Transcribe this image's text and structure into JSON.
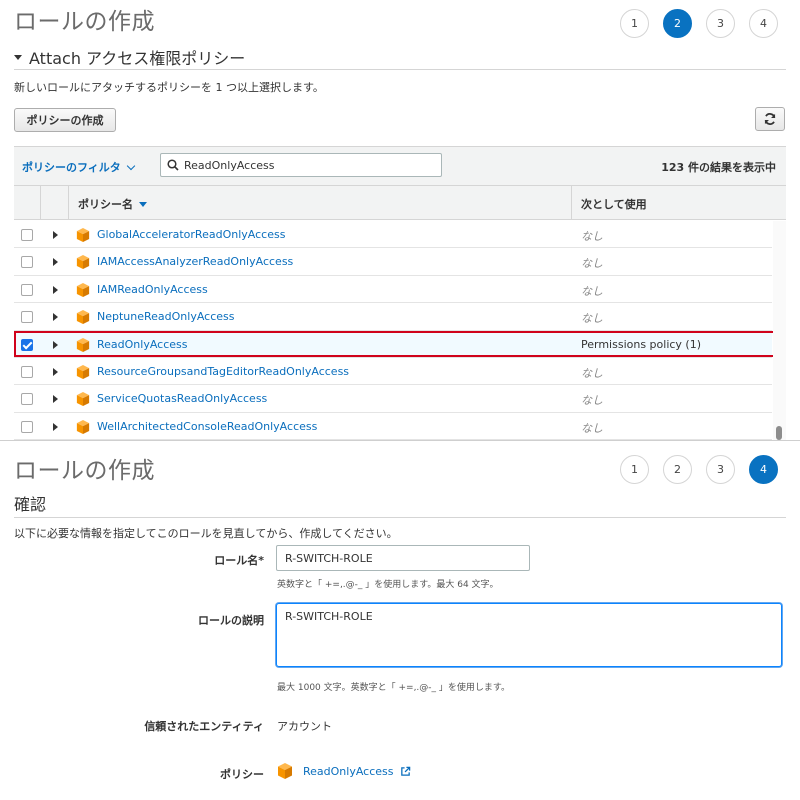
{
  "top": {
    "title": "ロールの作成",
    "steps": [
      "1",
      "2",
      "3",
      "4"
    ],
    "active_step": "2",
    "section_title": "Attach アクセス権限ポリシー",
    "description": "新しいロールにアタッチするポリシーを 1 つ以上選択します。",
    "create_policy_label": "ポリシーの作成",
    "filter_label": "ポリシーのフィルタ",
    "search_value": "ReadOnlyAccess",
    "result_count": "123 件の結果を表示中",
    "columns": {
      "name": "ポリシー名",
      "used_as": "次として使用"
    },
    "rows": [
      {
        "name": "GlobalAcceleratorReadOnlyAccess",
        "used_as": "なし",
        "checked": false
      },
      {
        "name": "IAMAccessAnalyzerReadOnlyAccess",
        "used_as": "なし",
        "checked": false
      },
      {
        "name": "IAMReadOnlyAccess",
        "used_as": "なし",
        "checked": false
      },
      {
        "name": "NeptuneReadOnlyAccess",
        "used_as": "なし",
        "checked": false
      },
      {
        "name": "ReadOnlyAccess",
        "used_as": "Permissions policy (1)",
        "checked": true
      },
      {
        "name": "ResourceGroupsandTagEditorReadOnlyAccess",
        "used_as": "なし",
        "checked": false
      },
      {
        "name": "ServiceQuotasReadOnlyAccess",
        "used_as": "なし",
        "checked": false
      },
      {
        "name": "WellArchitectedConsoleReadOnlyAccess",
        "used_as": "なし",
        "checked": false
      }
    ]
  },
  "bottom": {
    "title": "ロールの作成",
    "steps": [
      "1",
      "2",
      "3",
      "4"
    ],
    "active_step": "4",
    "section_title": "確認",
    "description": "以下に必要な情報を指定してこのロールを見直してから、作成してください。",
    "role_name_label": "ロール名*",
    "role_name_value": "R-SWITCH-ROLE",
    "role_name_hint": "英数字と「 +=,.@-_ 」を使用します。最大 64 文字。",
    "role_desc_label": "ロールの説明",
    "role_desc_value": "R-SWITCH-ROLE",
    "role_desc_hint": "最大 1000 文字。英数字と「 +=,.@-_ 」を使用します。",
    "trusted_entity_label": "信頼されたエンティティ",
    "trusted_entity_value": "アカウント",
    "policy_label": "ポリシー",
    "policy_value": "ReadOnlyAccess"
  },
  "colors": {
    "accent": "#0972c1",
    "link": "#0a6ebd",
    "highlight": "#d0021b",
    "cube": "#f79400"
  },
  "icons": [
    "caret-down-icon",
    "refresh-icon",
    "chevron-down-icon",
    "search-icon",
    "sort-caret-icon",
    "expand-triangle-icon",
    "policy-cube-icon",
    "external-link-icon"
  ]
}
